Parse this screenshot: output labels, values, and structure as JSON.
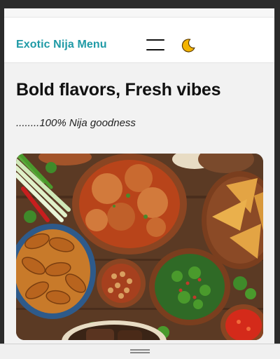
{
  "navbar": {
    "brand": "Exotic Nija Menu",
    "menu_icon": "hamburger-menu-icon",
    "theme_icon": "crescent-moon-icon"
  },
  "hero": {
    "headline": "Bold flavors, Fresh vibes",
    "tagline": "........100% Nija goodness",
    "image_description_icon": "food-spread-image"
  },
  "colors": {
    "brand": "#1f9aa6",
    "moon": "#f4b400",
    "background": "#f2f2f2",
    "navbar_bg": "#ffffff"
  }
}
